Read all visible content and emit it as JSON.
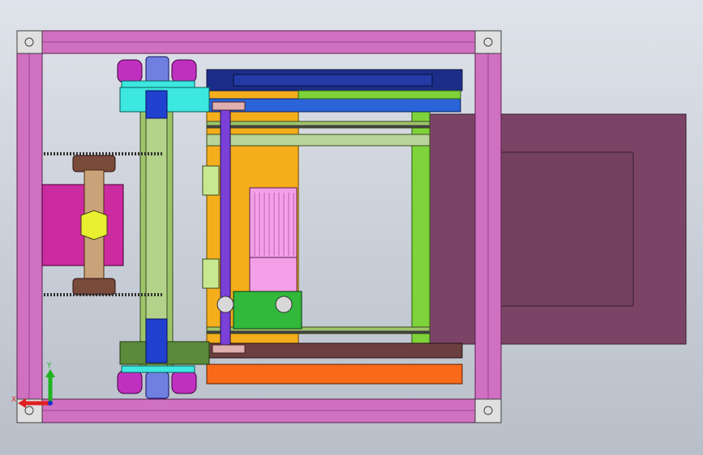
{
  "viewport": {
    "background": [
      "#dfe3ea",
      "#b8bfc9"
    ]
  },
  "triad": {
    "y_label": "Y",
    "x_label": "X",
    "colors": {
      "y": "#1fb21f",
      "x": "#e02020",
      "z": "#1e2fd0"
    }
  },
  "colors": {
    "frame_magenta": "#d070c0",
    "frame_dark": "#a04090",
    "lavender_face": "#6e3f63",
    "orange_plate": "#f4ad1b",
    "navy_bar": "#1b2d88",
    "blue_bar": "#2a64d8",
    "green_plate": "#7ed23a",
    "olive_rail": "#9ec46a",
    "cyan_block": "#3ce8e0",
    "pink_motor": "#f4a0e8",
    "orange_bottom": "#f86a1a",
    "purple_shaft": "#7a40d8",
    "bronze_roller": "#c9a27a"
  },
  "parts": [
    "outer-frame",
    "caster-wheel",
    "drive-chain",
    "roller-shaft",
    "motor",
    "gear-box",
    "housing-plate",
    "conveyor-rail"
  ]
}
